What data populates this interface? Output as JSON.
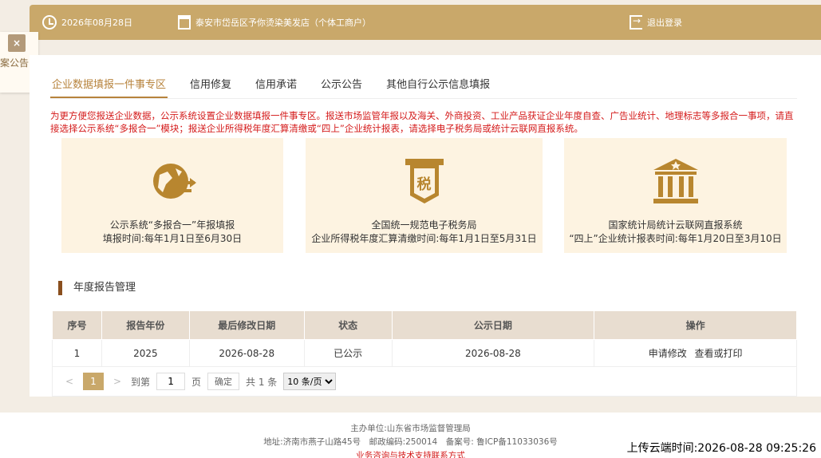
{
  "header": {
    "date": "2026年08月28日",
    "shop": "泰安市岱岳区予你烫染美发店（个体工商户）",
    "logout": "退出登录"
  },
  "side_notice": {
    "close": "×",
    "text": "案公告"
  },
  "tabs": [
    "企业数据填报一件事专区",
    "信用修复",
    "信用承诺",
    "公示公告",
    "其他自行公示信息填报"
  ],
  "notice_text": "为更方便您报送企业数据，公示系统设置企业数据填报一件事专区。报送市场监管年报以及海关、外商投资、工业产品获证企业年度自查、广告业统计、地理标志等多报合一事项，请直接选择公示系统“多报合一”模块；报送企业所得税年度汇算清缴或“四上”企业统计报表，请选择电子税务局或统计云联网直报系统。",
  "cards": [
    {
      "line1": "公示系统“多报合一”年报填报",
      "line2": "填报时间:每年1月1日至6月30日",
      "icon": "globe-arrows-icon"
    },
    {
      "line1": "全国统一规范电子税务局",
      "line2": "企业所得税年度汇算清缴时间:每年1月1日至5月31日",
      "icon": "tax-icon",
      "icon_text": "税"
    },
    {
      "line1": "国家统计局统计云联网直报系统",
      "line2": "“四上”企业统计报表时间:每年1月20日至3月10日",
      "icon": "government-building-icon"
    }
  ],
  "section_title": "年度报告管理",
  "table": {
    "headers": [
      "序号",
      "报告年份",
      "最后修改日期",
      "状态",
      "公示日期",
      "操作"
    ],
    "rows": [
      {
        "no": "1",
        "year": "2025",
        "modified": "2026-08-28",
        "status": "已公示",
        "published": "2026-08-28",
        "op1": "申请修改",
        "op2": "查看或打印"
      }
    ]
  },
  "pager": {
    "prev": "<",
    "current": "1",
    "next": ">",
    "goto": "到第",
    "page_value": "1",
    "page_unit": "页",
    "confirm": "确定",
    "total": "共 1 条",
    "page_size": "10 条/页"
  },
  "footer": {
    "line1": "主办单位:山东省市场监督管理局",
    "line2": "地址:济南市燕子山路45号　邮政编码:250014　备案号: 鲁ICP备11033036号",
    "line3": "业务咨询与技术支持联系方式"
  },
  "upload_time": "上传云端时间:2026-08-28 09:25:26",
  "colors": {
    "gold": "#c9a86a",
    "accent": "#b7833c",
    "red": "#d41a1a",
    "card_bg": "#fdf3e1"
  }
}
